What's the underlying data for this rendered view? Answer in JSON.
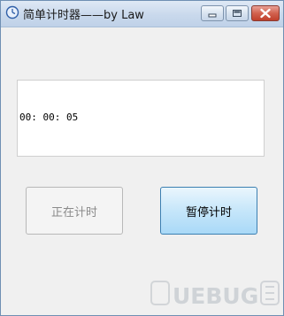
{
  "window": {
    "title": "简单计时器——by Law"
  },
  "display": {
    "time": "00: 00: 05"
  },
  "buttons": {
    "running_label": "正在计时",
    "pause_label": "暂停计时"
  },
  "watermark": {
    "text": "UEBUG"
  },
  "colors": {
    "titlebar": "#c9d9ec",
    "close_button": "#d2624f",
    "pause_button": "#c6e6fa"
  },
  "icons": {
    "app": "clock-icon",
    "minimize": "minimize-icon",
    "maximize": "maximize-icon",
    "close": "close-icon"
  }
}
